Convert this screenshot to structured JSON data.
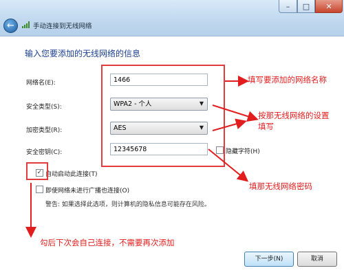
{
  "window": {
    "title": "手动连接到无线网络",
    "back_icon": "arrow-left-icon",
    "minimize": "–",
    "maximize": "□",
    "close": "✕"
  },
  "heading": "输入您要添加的无线网络的信息",
  "form": {
    "network_name_label": "网络名(E):",
    "network_name_value": "1466",
    "security_type_label": "安全类型(S):",
    "security_type_value": "WPA2 - 个人",
    "encryption_type_label": "加密类型(R):",
    "encryption_type_value": "AES",
    "security_key_label": "安全密钥(C):",
    "security_key_value": "12345678",
    "hide_chars_label": "隐藏字符(H)",
    "hide_chars_checked": false
  },
  "options": {
    "auto_connect_label": "自动启动此连接(T)",
    "auto_connect_checked": true,
    "connect_hidden_label": "即使网络未进行广播也连接(O)",
    "connect_hidden_checked": false,
    "warning": "警告: 如果选择此选项，则计算机的隐私信息可能存在风险。"
  },
  "annotations": {
    "note_name": "填写要添加的网络名称",
    "note_security_line1": "按那无线网络的设置",
    "note_security_line2": "填写",
    "note_password": "填那无线网络密码",
    "note_auto": "勾后下次会自己连接，不需要再次添加",
    "color": "#e21d1d"
  },
  "buttons": {
    "next": "下一步(N)",
    "cancel": "取消"
  }
}
